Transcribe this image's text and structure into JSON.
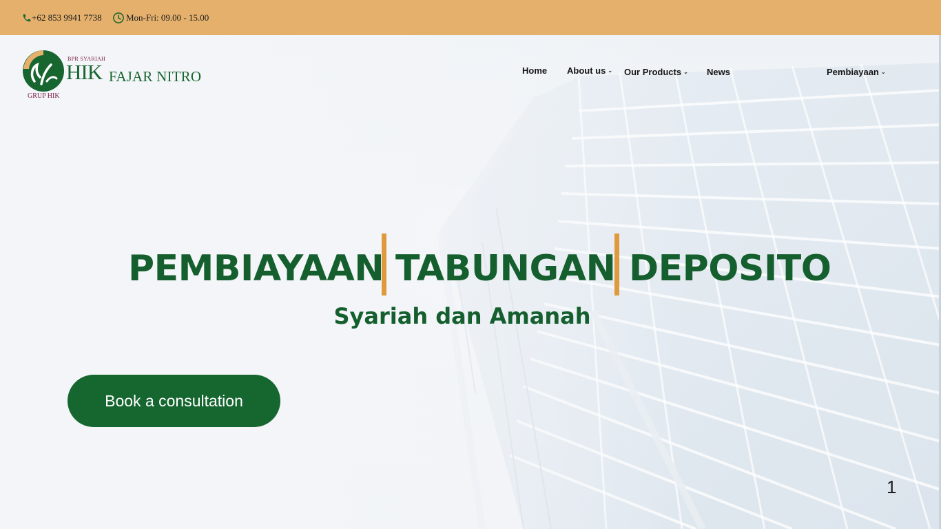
{
  "topbar": {
    "phone": "+62 853 9941 7738",
    "phone_icon": "phone-icon",
    "hours": "Mon-Fri: 09.00 - 15.00",
    "hours_icon": "clock-icon"
  },
  "logo": {
    "prefix": "BPR SYARIAH",
    "brand": "HIK",
    "name": "FAJAR NITRO",
    "group": "GRUP HIK"
  },
  "nav": {
    "items": [
      {
        "label": "Home"
      },
      {
        "label": "About us",
        "icon": "chevron-down-icon"
      },
      {
        "label": "Our Products",
        "icon": "chevron-down-icon"
      },
      {
        "label": "News"
      },
      {
        "label": "Pembiayaan",
        "icon": "chevron-down-icon"
      }
    ]
  },
  "hero": {
    "headline": [
      "PEMBIAYAAN",
      "TABUNGAN",
      "DEPOSITO"
    ],
    "subtitle": "Syariah dan Amanah",
    "cta_label": "Book a consultation",
    "slide_number": "1"
  },
  "colors": {
    "topbar": "#e4b06c",
    "brand_green": "#166630",
    "accent_orange": "#e09a3e",
    "logo_maroon": "#7b1f49"
  }
}
